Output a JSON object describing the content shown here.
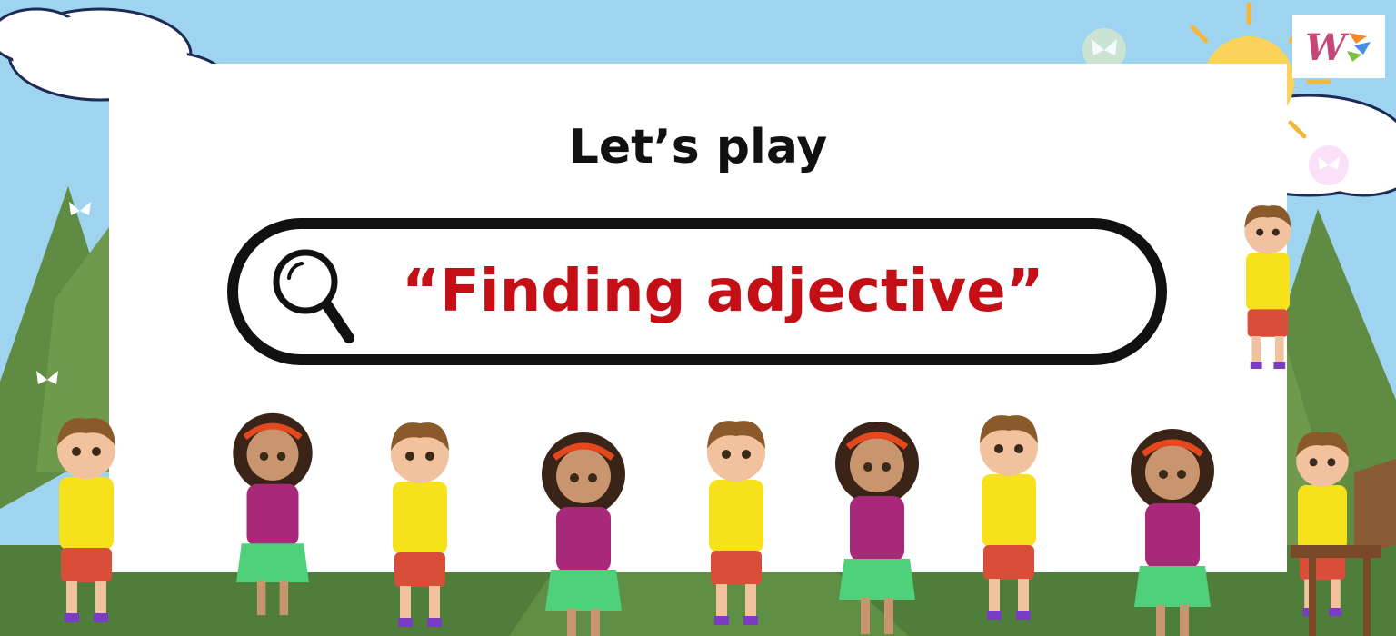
{
  "heading": "Let’s play",
  "search_bar": {
    "text": "“Finding adjective”",
    "icon": "magnifier-icon"
  },
  "logo": {
    "letter": "W"
  },
  "colors": {
    "sky": "#9ed4ef",
    "grass": "#4f7e3a",
    "hill": "#5f8b42",
    "title_text": "#111111",
    "search_text": "#c40f17",
    "sun": "#fbd35a"
  },
  "scene": {
    "characters": [
      "boy-walking",
      "girl-walking-side",
      "boy-waving",
      "girl-crying",
      "boy-sleepy",
      "girl-scared",
      "boy-angry-pointing",
      "girl-surprised",
      "boy-sitting",
      "boy-climbing"
    ]
  }
}
